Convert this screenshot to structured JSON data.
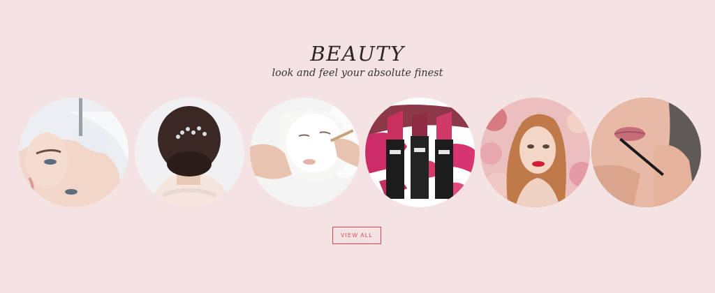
{
  "section": {
    "title": "BEAUTY",
    "subtitle": "look and feel your absolute finest"
  },
  "categories": [
    {
      "icon": "microblading-photo"
    },
    {
      "icon": "bridal-hair-photo"
    },
    {
      "icon": "facial-mask-photo"
    },
    {
      "icon": "lipstick-photo"
    },
    {
      "icon": "glam-makeup-photo"
    },
    {
      "icon": "lip-liner-photo"
    }
  ],
  "cta": {
    "label": "VIEW ALL"
  },
  "colors": {
    "background": "#f5e3e3",
    "accent": "#d9435a",
    "heading": "#2c2626"
  }
}
